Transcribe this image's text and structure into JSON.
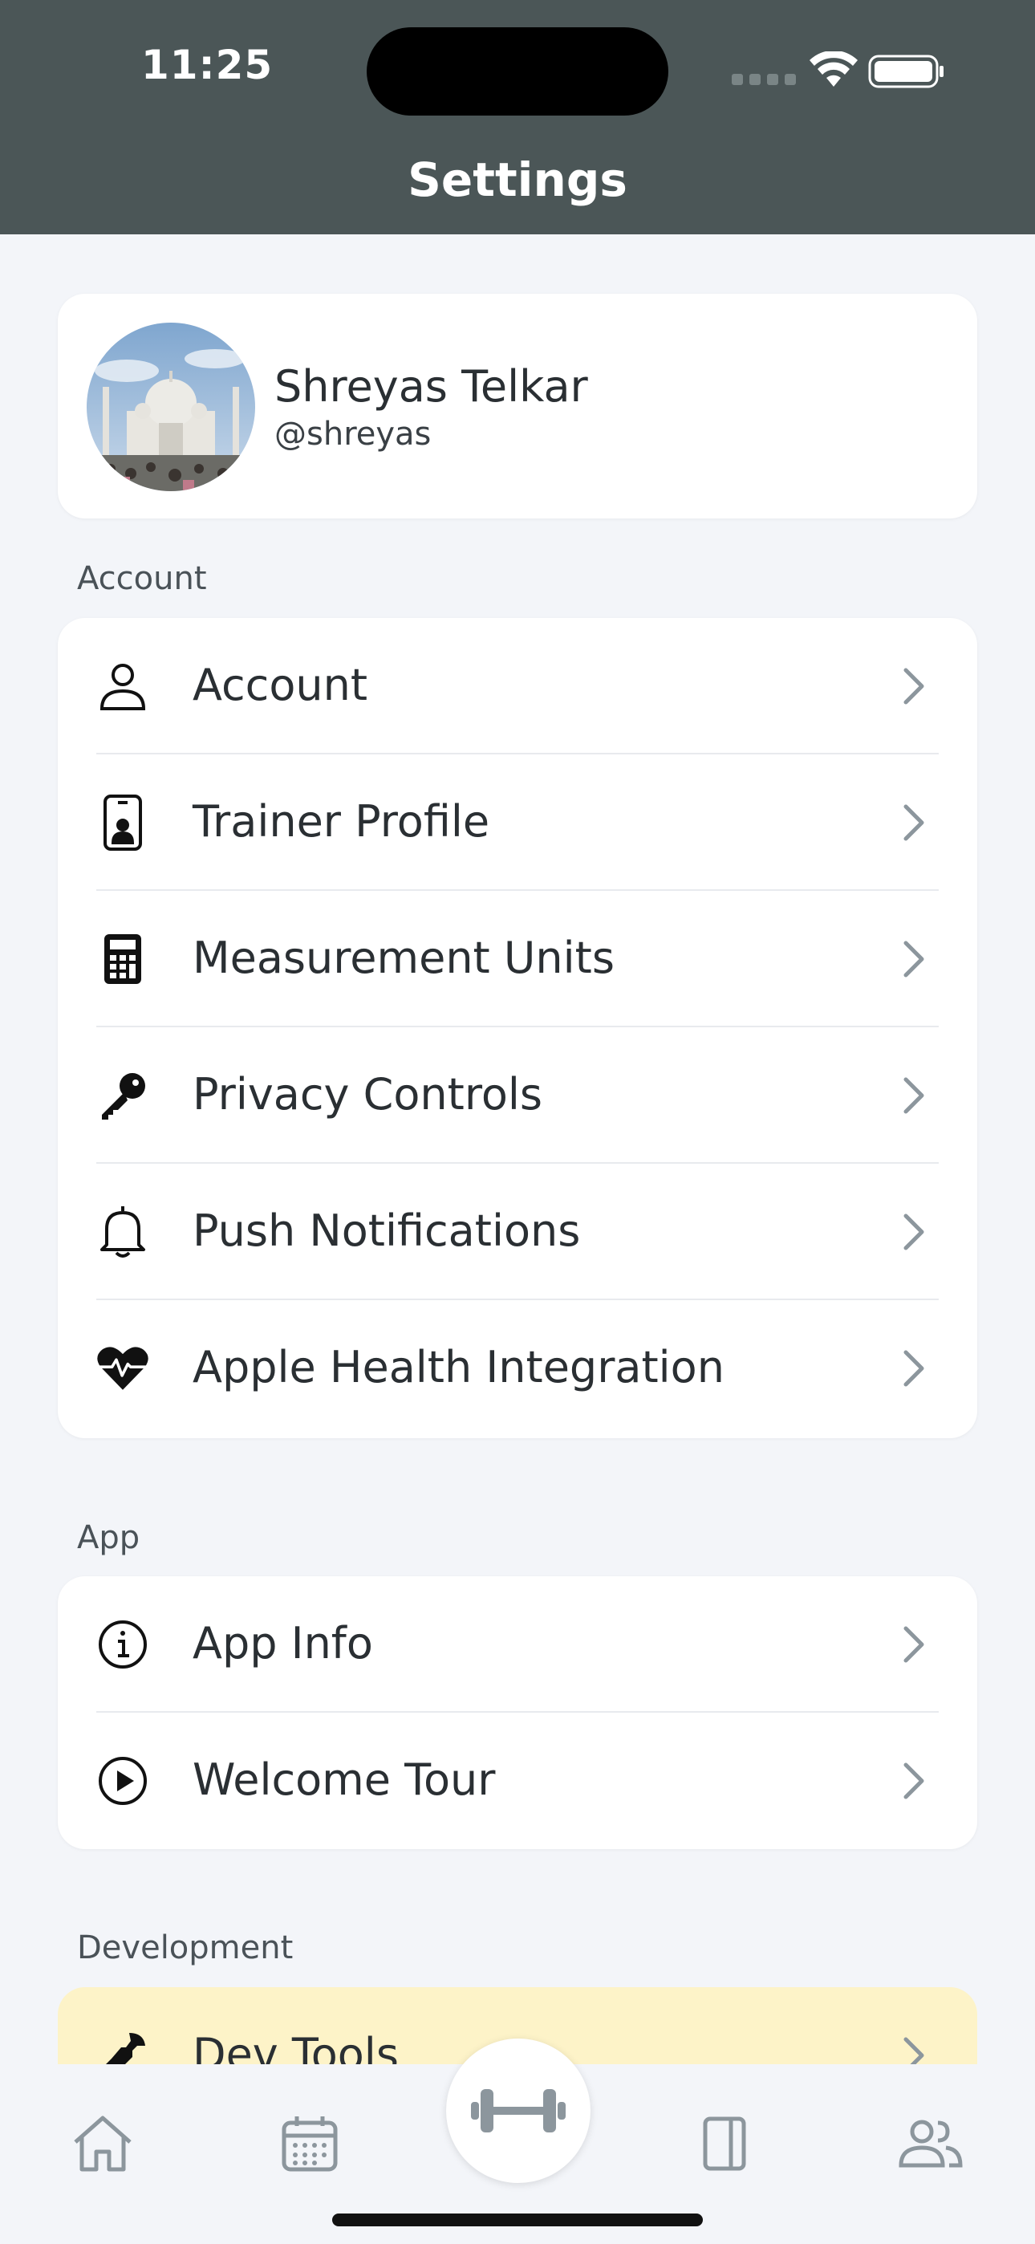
{
  "status_bar": {
    "time": "11:25"
  },
  "header": {
    "title": "Settings"
  },
  "profile": {
    "name": "Shreyas Telkar",
    "handle": "@shreyas"
  },
  "sections": {
    "account": {
      "title": "Account",
      "items": [
        {
          "label": "Account",
          "icon": "person-icon"
        },
        {
          "label": "Trainer Profile",
          "icon": "id-badge-icon"
        },
        {
          "label": "Measurement Units",
          "icon": "calculator-icon"
        },
        {
          "label": "Privacy Controls",
          "icon": "key-icon"
        },
        {
          "label": "Push Notifications",
          "icon": "bell-icon"
        },
        {
          "label": "Apple Health Integration",
          "icon": "heart-pulse-icon"
        }
      ]
    },
    "app": {
      "title": "App",
      "items": [
        {
          "label": "App Info",
          "icon": "info-icon"
        },
        {
          "label": "Welcome Tour",
          "icon": "play-circle-icon"
        }
      ]
    },
    "development": {
      "title": "Development",
      "items": [
        {
          "label": "Dev Tools",
          "icon": "wrench-icon"
        }
      ]
    }
  },
  "tabbar": {
    "items": [
      "home-icon",
      "calendar-icon",
      "dumbbell-icon",
      "journal-icon",
      "people-icon"
    ],
    "active": "dumbbell-icon"
  },
  "colors": {
    "header_bg": "#4b5657",
    "page_bg": "#f3f5f9",
    "dev_card_bg": "#fdf3c8",
    "icon_gray": "#8c969d"
  }
}
